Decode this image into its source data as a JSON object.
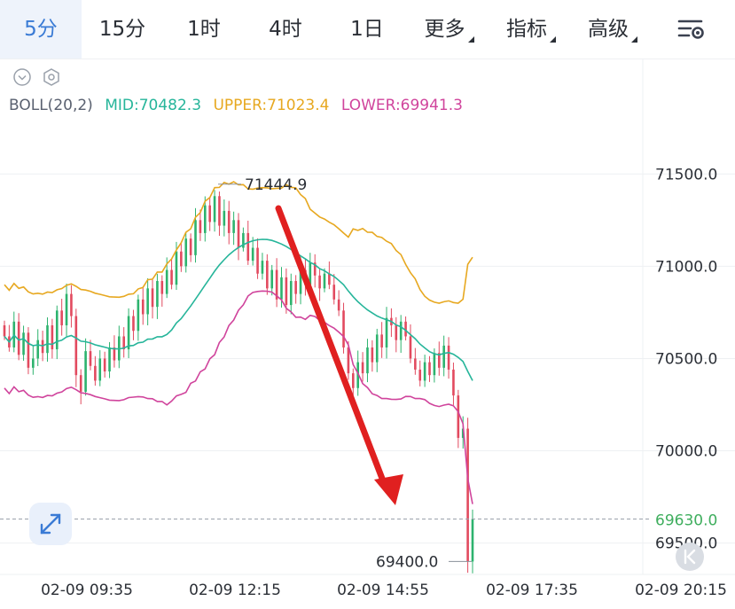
{
  "tabs": [
    {
      "label": "5分",
      "active": true
    },
    {
      "label": "15分"
    },
    {
      "label": "1时"
    },
    {
      "label": "4时"
    },
    {
      "label": "1日"
    },
    {
      "label": "更多",
      "dropdown": true
    },
    {
      "label": "指标",
      "dropdown": true
    },
    {
      "label": "高级",
      "dropdown": true
    }
  ],
  "icons": {
    "settings": "settings-sliders-icon",
    "collapse": "chevron-circle-icon",
    "gear": "hexagon-gear-icon",
    "expand": "expand-arrows-icon",
    "back": "back-to-latest-icon"
  },
  "colors": {
    "active_tab": "#3a7bd5",
    "mid": "#26b59a",
    "upper": "#e7a820",
    "lower": "#d0449c",
    "up": "#2db36e",
    "down": "#e24a5f",
    "current_price": "#3fae5e",
    "arrow": "#e02020"
  },
  "legend": {
    "name": "BOLL(20,2)",
    "mid": "MID:70482.3",
    "upper": "UPPER:71023.4",
    "lower": "LOWER:69941.3"
  },
  "chart_data": {
    "type": "candlestick",
    "indicator": "BOLL(20,2)",
    "y_ticks": [
      "71500.0",
      "71000.0",
      "70500.0",
      "70000.0",
      "69500.0"
    ],
    "x_ticks": [
      "02-09 09:35",
      "02-09 12:15",
      "02-09 14:55",
      "02-09 17:35",
      "02-09 20:15"
    ],
    "ylim": [
      69330,
      71780
    ],
    "grid": true,
    "annotations": {
      "high": {
        "label": "71444.9",
        "value": 71444.9
      },
      "low": {
        "label": "69400.0",
        "value": 69400.0
      },
      "current_price": {
        "label": "69630.0",
        "value": 69630.0
      },
      "arrow": "downward red trend arrow"
    },
    "closes": [
      70620,
      70560,
      70700,
      70520,
      70640,
      70450,
      70500,
      70600,
      70530,
      70680,
      70550,
      70760,
      70680,
      70850,
      70730,
      70410,
      70320,
      70540,
      70460,
      70380,
      70500,
      70430,
      70560,
      70490,
      70620,
      70550,
      70730,
      70650,
      70820,
      70740,
      70880,
      70780,
      70920,
      70850,
      70980,
      70900,
      71080,
      71000,
      71150,
      71060,
      71250,
      71180,
      71330,
      71240,
      71380,
      71220,
      71300,
      71180,
      71250,
      71100,
      71180,
      71030,
      71100,
      70960,
      71030,
      70880,
      70980,
      70820,
      70940,
      70790,
      70920,
      70850,
      70980,
      70900,
      71020,
      70950,
      70880,
      70960,
      70900,
      70820,
      70760,
      70560,
      70420,
      70340,
      70480,
      70420,
      70560,
      70480,
      70630,
      70560,
      70720,
      70680,
      70600,
      70700,
      70620,
      70500,
      70440,
      70380,
      70480,
      70410,
      70530,
      70450,
      70570,
      70440,
      70300,
      70070,
      70120,
      69400,
      69630
    ]
  }
}
